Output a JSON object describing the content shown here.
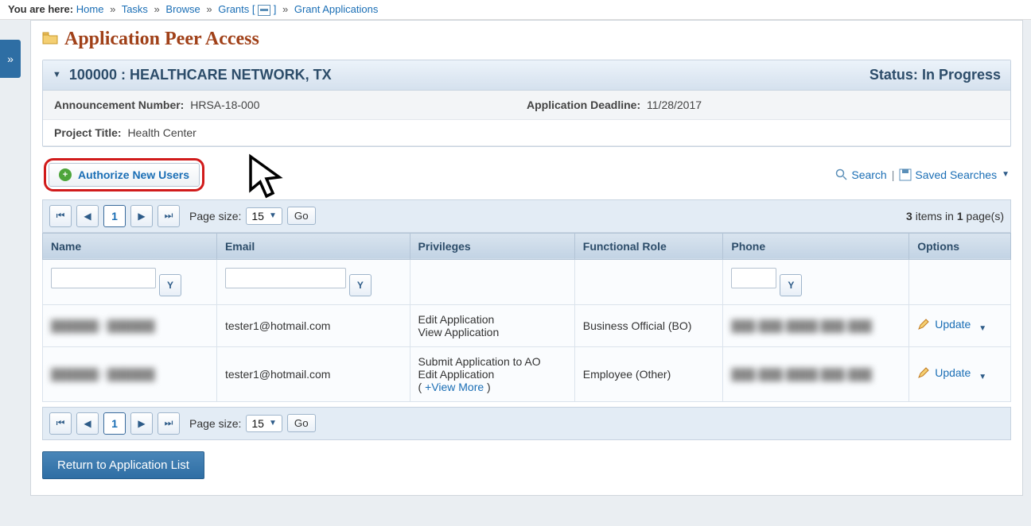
{
  "breadcrumb": {
    "prefix": "You are here:",
    "items": [
      "Home",
      "Tasks",
      "Browse",
      "Grants [icon]",
      "Grant Applications"
    ]
  },
  "page_title": "Application Peer Access",
  "panel": {
    "title": "100000 : HEALTHCARE NETWORK, TX",
    "status_label": "Status:",
    "status_value": "In Progress"
  },
  "info": {
    "announcement_label": "Announcement Number:",
    "announcement_value": "HRSA-18-000",
    "deadline_label": "Application Deadline:",
    "deadline_value": "11/28/2017",
    "project_label": "Project Title:",
    "project_value": "Health Center"
  },
  "toolbar": {
    "authorize_label": "Authorize New Users",
    "search_label": "Search",
    "saved_searches_label": "Saved Searches"
  },
  "pager": {
    "page_size_label": "Page size:",
    "page_size_value": "15",
    "go_label": "Go",
    "current_page": "1",
    "info_items": "3",
    "info_pages": "1",
    "info_template_a": "items in",
    "info_template_b": "page(s)"
  },
  "columns": {
    "name": "Name",
    "email": "Email",
    "privileges": "Privileges",
    "role": "Functional Role",
    "phone": "Phone",
    "options": "Options"
  },
  "rows": [
    {
      "name_blurred": "██████ / ██████",
      "email": "tester1@hotmail.com",
      "privileges_lines": [
        "Edit Application",
        "View Application"
      ],
      "view_more": false,
      "role": "Business Official (BO)",
      "phone_blurred": "███-███-████ ███-███",
      "option_label": "Update"
    },
    {
      "name_blurred": "██████ / ██████",
      "email": "tester1@hotmail.com",
      "privileges_lines": [
        "Submit Application to AO",
        "Edit Application"
      ],
      "view_more": true,
      "view_more_label": "+View More",
      "role": "Employee (Other)",
      "phone_blurred": "███-███-████ ███-███",
      "option_label": "Update"
    }
  ],
  "return_label": "Return to Application List"
}
